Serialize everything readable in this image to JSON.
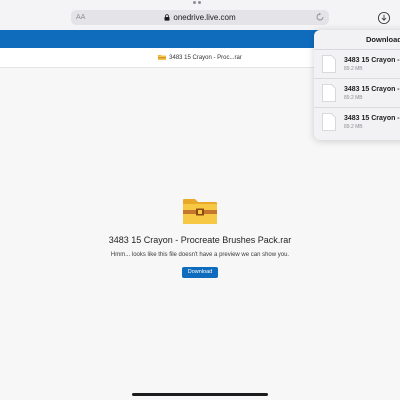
{
  "browser": {
    "text_size_label": "AA",
    "url": "onedrive.live.com"
  },
  "file_header": {
    "title": "3483 15 Crayon - Proc...rar"
  },
  "preview": {
    "file_name": "3483 15 Crayon - Procreate Brushes Pack.rar",
    "message": "Hmm... looks like this file doesn't have a preview we can show you.",
    "download_label": "Download"
  },
  "downloads_popover": {
    "title": "Download",
    "items": [
      {
        "name": "3483 15 Crayon -",
        "size": "89.2 MB"
      },
      {
        "name": "3483 15 Crayon -",
        "size": "89.2 MB"
      },
      {
        "name": "3483 15 Crayon -",
        "size": "89.2 MB"
      }
    ]
  },
  "colors": {
    "onedrive_blue": "#0f6cbd",
    "folder_yellow": "#f7c844",
    "folder_band": "#c5762c"
  },
  "icons": [
    "lock-icon",
    "reload-icon",
    "downloads-icon",
    "folder-icon",
    "document-icon"
  ]
}
